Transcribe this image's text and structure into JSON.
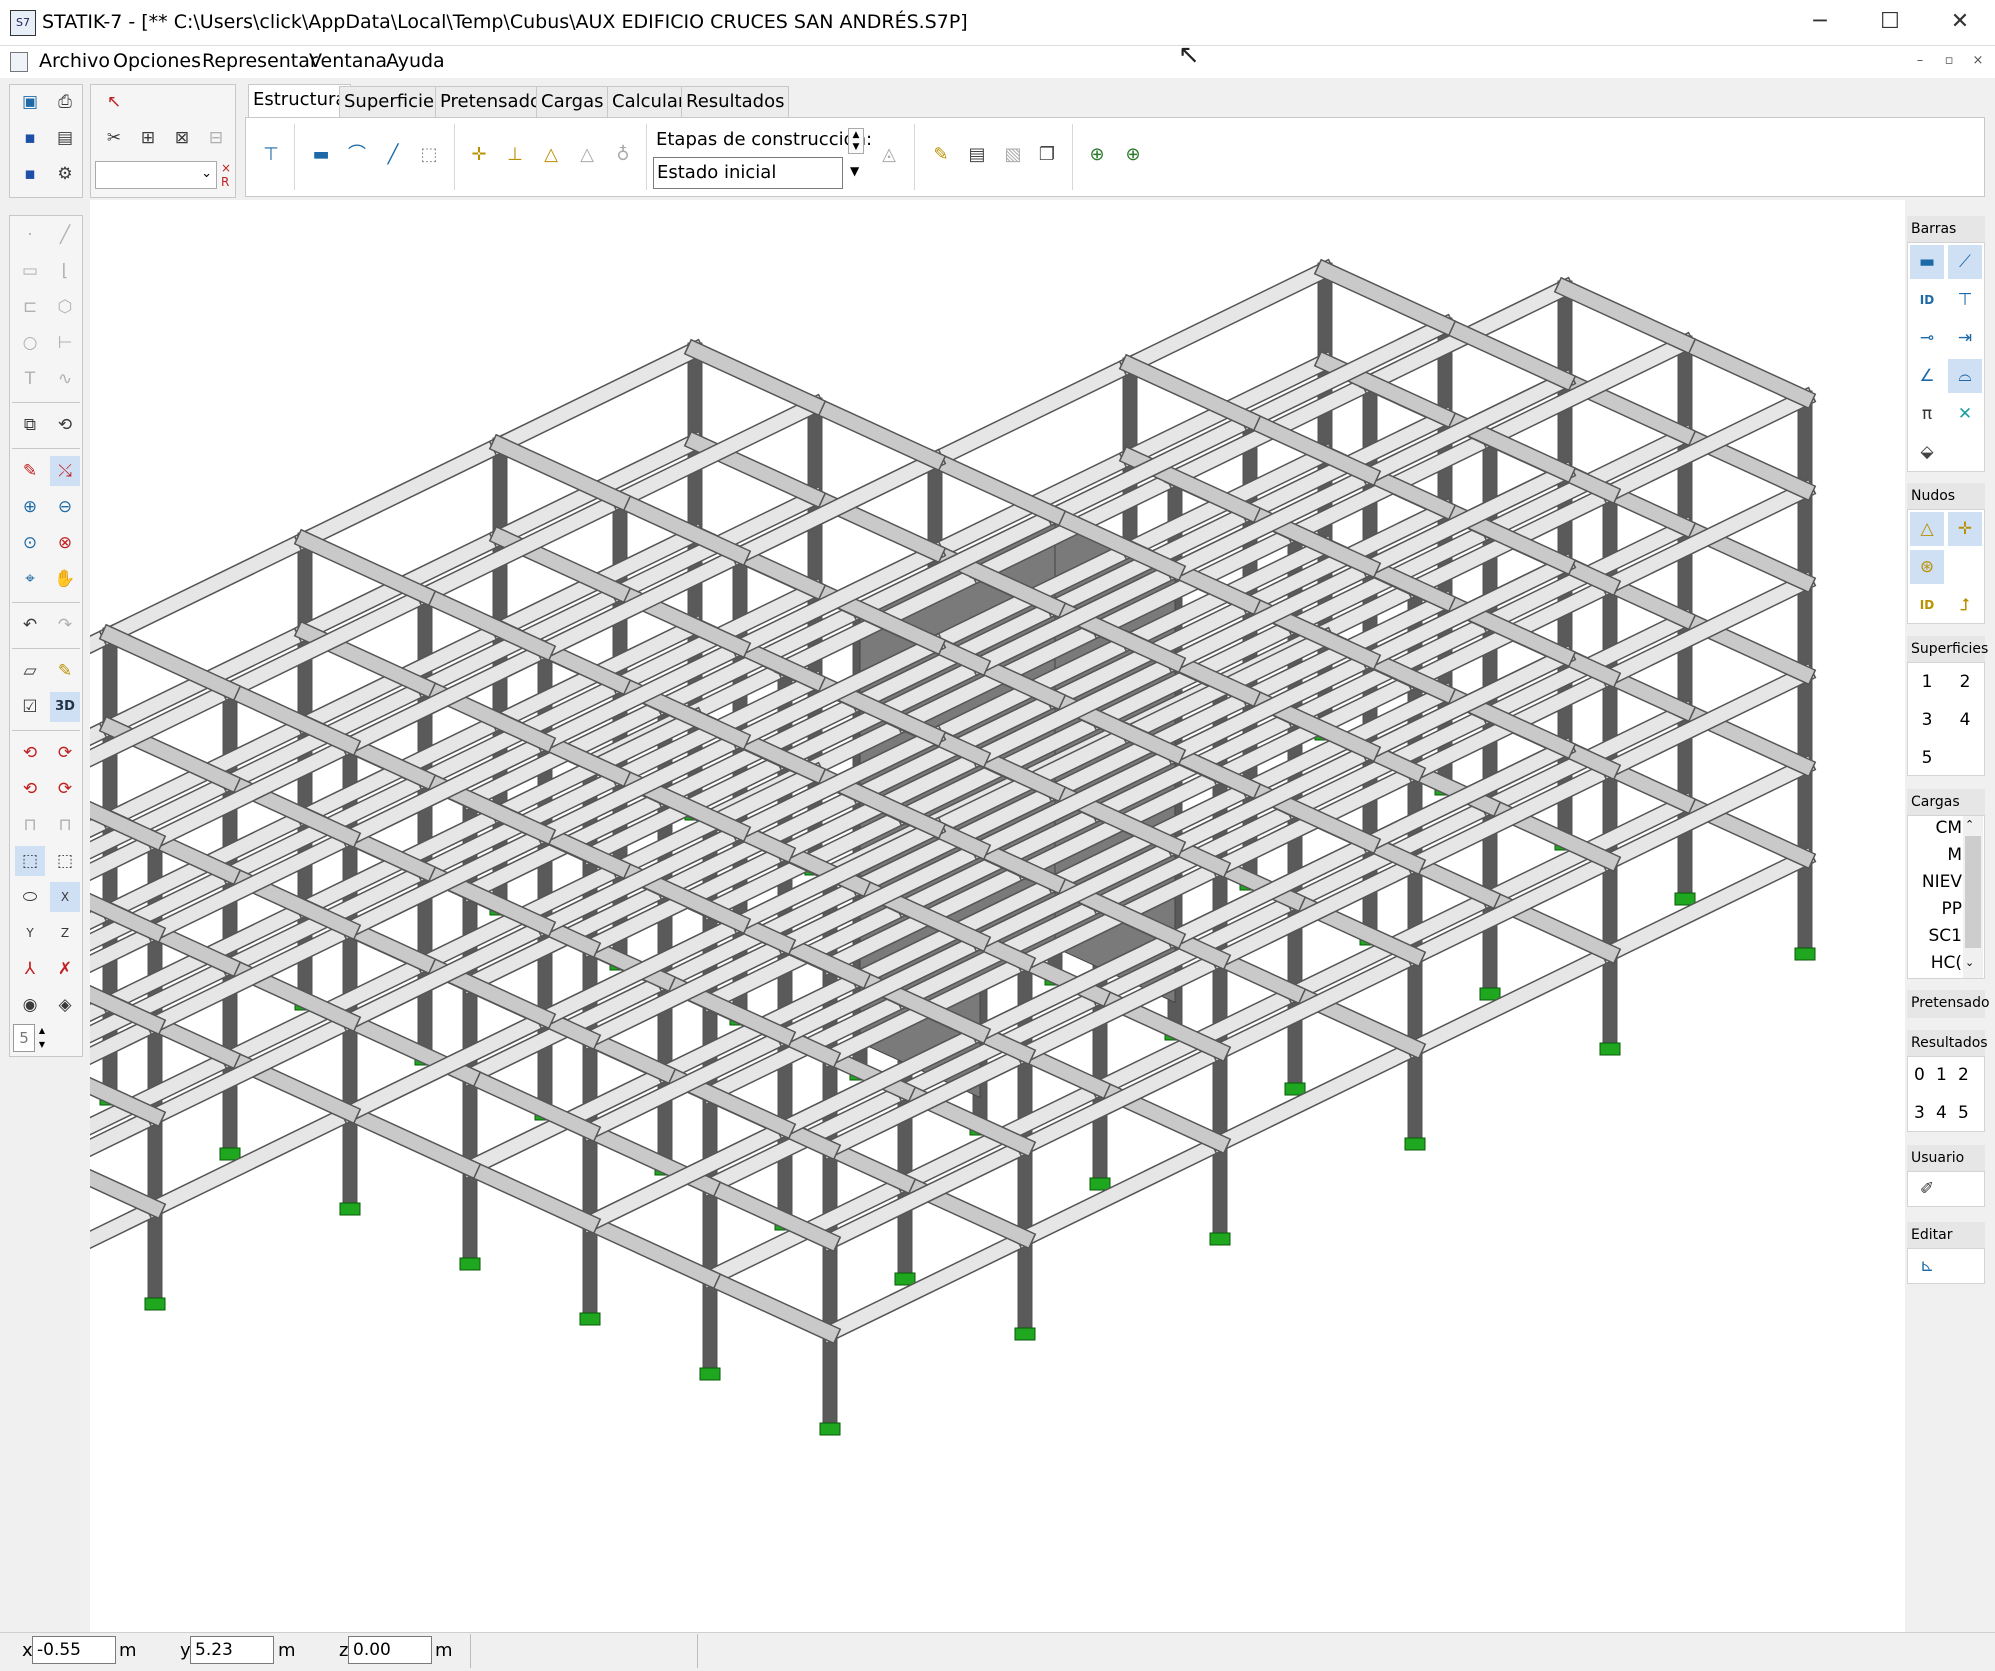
{
  "window": {
    "title": "STATIK-7 - [** C:\\Users\\click\\AppData\\Local\\Temp\\Cubus\\AUX EDIFICIO CRUCES SAN ANDRÉS.S7P]",
    "app_icon_text": "S7",
    "minimize": "─",
    "maximize": "☐",
    "close": "✕"
  },
  "menu": {
    "items": [
      "Archivo",
      "Opciones",
      "Representar",
      "Ventana",
      "Ayuda"
    ],
    "mdi_min": "–",
    "mdi_restore": "▫",
    "mdi_close": "×"
  },
  "ribbon": {
    "tabs": [
      "Estructura",
      "Superficies",
      "Pretensado",
      "Cargas",
      "Calcular",
      "Resultados"
    ],
    "active_tab": "Estructura",
    "construction_stages_label": "Etapas de construcción:",
    "construction_stage_value": "Estado inicial"
  },
  "left_toolbar": {
    "view_3d_label": "3D",
    "axis_labels": [
      "X",
      "Y",
      "Z"
    ],
    "spinner_value": "5"
  },
  "selector_combo": {
    "value": ""
  },
  "right_panels": {
    "barras": {
      "title": "Barras"
    },
    "nudos": {
      "title": "Nudos"
    },
    "superficies": {
      "title": "Superficies",
      "buttons": [
        "1",
        "2",
        "3",
        "4",
        "5"
      ]
    },
    "cargas": {
      "title": "Cargas",
      "items": [
        "CM",
        "M",
        "NIEV",
        "PP",
        "SC1",
        "HC("
      ]
    },
    "pretensado": {
      "title": "Pretensado"
    },
    "resultados": {
      "title": "Resultados",
      "buttons": [
        "0",
        "1",
        "2",
        "3",
        "4",
        "5"
      ]
    },
    "usuario": {
      "title": "Usuario"
    },
    "editar": {
      "title": "Editar"
    }
  },
  "status": {
    "x_label": "x",
    "x_value": "-0.55",
    "x_unit": "m",
    "y_label": "y",
    "y_value": "5.23",
    "y_unit": "m",
    "z_label": "z",
    "z_value": "0.00",
    "z_unit": "m"
  },
  "colors": {
    "beam_light": "#e6e6e6",
    "beam_mid": "#c9c9c9",
    "column_dark": "#5a5a5a",
    "wall_gray": "#7a7a7a",
    "support_green": "#1fa81f",
    "selected_button": "#cfe0f5",
    "icon_blue": "#1e6aa8"
  }
}
